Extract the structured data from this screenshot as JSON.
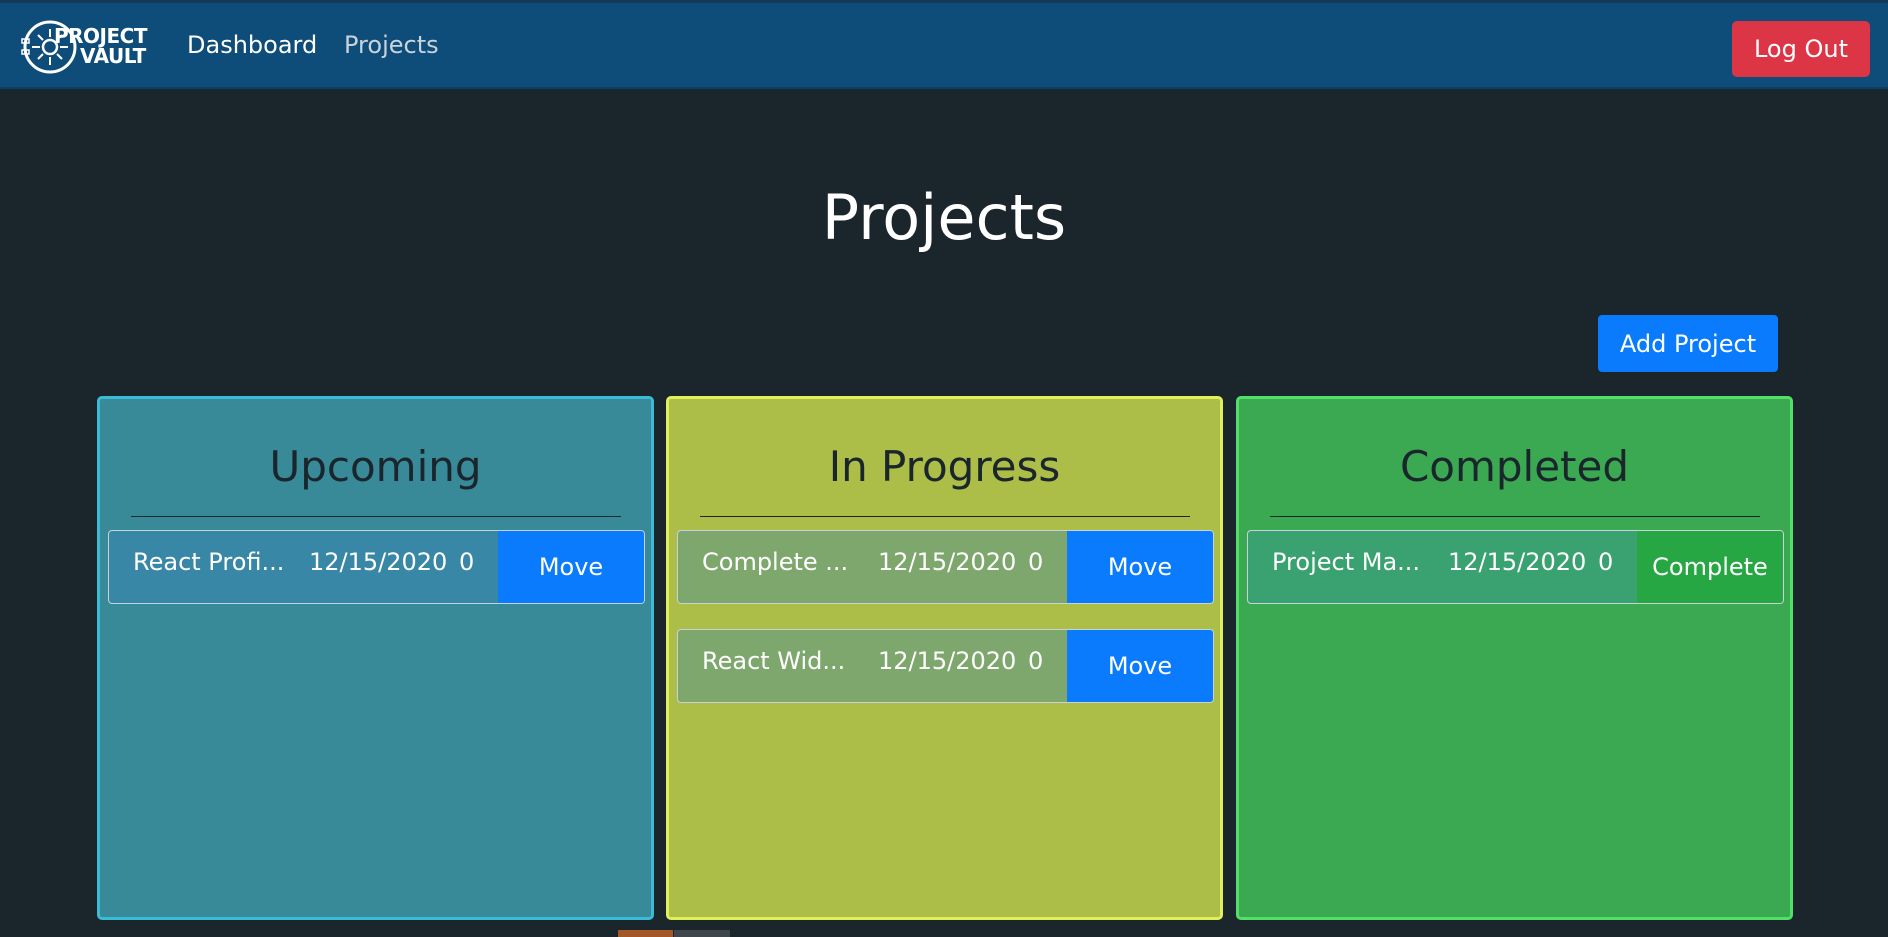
{
  "navbar": {
    "brand_line1": "PROJECT",
    "brand_line2": "VAULT",
    "links": [
      {
        "label": "Dashboard"
      },
      {
        "label": "Projects"
      }
    ],
    "logout_label": "Log Out"
  },
  "page": {
    "title": "Projects",
    "add_button_label": "Add Project"
  },
  "columns": [
    {
      "title": "Upcoming",
      "color": "#388a99",
      "cards": [
        {
          "name": "React Profi...",
          "date": "12/15/2020",
          "count": "0",
          "action": "Move"
        }
      ]
    },
    {
      "title": "In Progress",
      "color": "#acbe48",
      "cards": [
        {
          "name": "Complete ...",
          "date": "12/15/2020",
          "count": "0",
          "action": "Move"
        },
        {
          "name": "React Wid...",
          "date": "12/15/2020",
          "count": "0",
          "action": "Move"
        }
      ]
    },
    {
      "title": "Completed",
      "color": "#3ba951",
      "cards": [
        {
          "name": "Project Ma...",
          "date": "12/15/2020",
          "count": "0",
          "action": "Complete"
        }
      ]
    }
  ]
}
